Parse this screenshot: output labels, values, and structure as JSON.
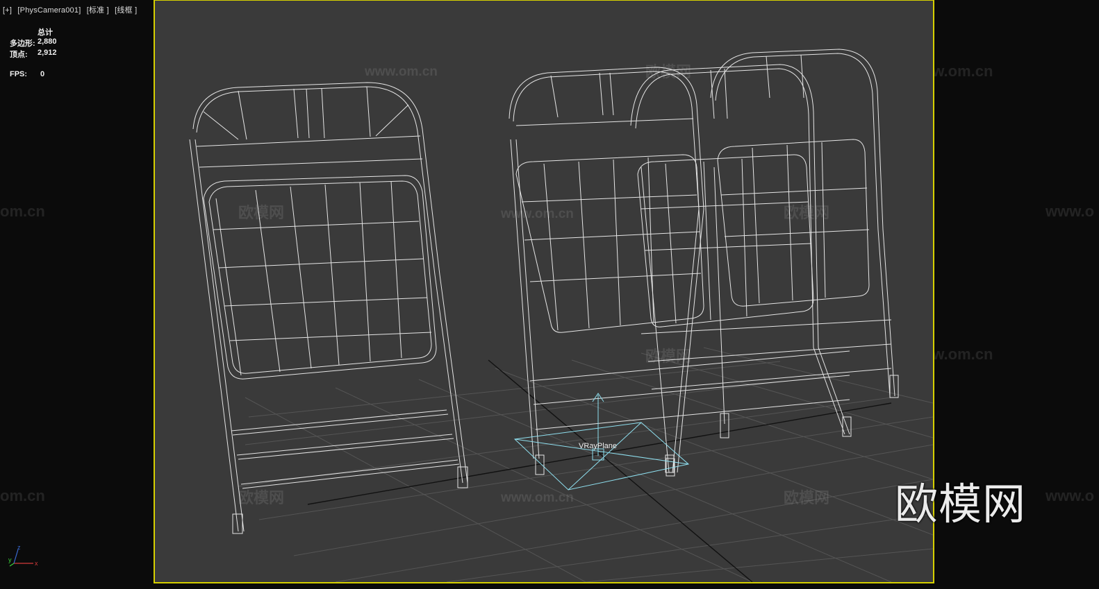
{
  "viewport_label": {
    "plus": "[+]",
    "camera": "[PhysCamera001]",
    "shading": "[标准 ]",
    "mode": "[线框 ]"
  },
  "stats": {
    "total_label": "总计",
    "polys_label": "多边形:",
    "polys_value": "2,880",
    "verts_label": "顶点:",
    "verts_value": "2,912",
    "fps_label": "FPS:",
    "fps_value": "0"
  },
  "scene": {
    "object_label": "VRayPlane",
    "wire_color": "#e6e6e6",
    "helper_color": "#8fe0f0",
    "frame_color": "#d6d000"
  },
  "watermarks": {
    "cn": "欧模网",
    "url": "www.om.cn",
    "url_short": "www.o",
    "url_tail": "om.cn",
    "brand": "欧模网"
  },
  "axis": {
    "x": "x",
    "y": "y",
    "z": "z"
  }
}
